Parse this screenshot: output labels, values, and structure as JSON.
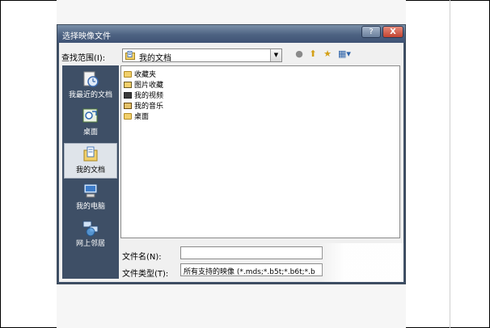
{
  "dialog": {
    "title": "选择映像文件",
    "help_glyph": "?",
    "close_glyph": "X"
  },
  "lookin": {
    "label": "查找范围(I):",
    "value": "我的文档",
    "arrow": "▼"
  },
  "toolbar": {
    "back": "●",
    "up": "⬆",
    "new_folder": "★",
    "views": "▦▾"
  },
  "places": [
    {
      "label": "我最近的文档",
      "icon": "recent-documents-icon"
    },
    {
      "label": "桌面",
      "icon": "desktop-icon"
    },
    {
      "label": "我的文档",
      "icon": "my-documents-icon",
      "selected": true
    },
    {
      "label": "我的电脑",
      "icon": "my-computer-icon"
    },
    {
      "label": "网上邻居",
      "icon": "network-places-icon"
    }
  ],
  "files": [
    {
      "name": "收藏夹",
      "icon": "folder-icon"
    },
    {
      "name": "图片收藏",
      "icon": "pictures-folder-icon"
    },
    {
      "name": "我的视频",
      "icon": "videos-folder-icon"
    },
    {
      "name": "我的音乐",
      "icon": "music-folder-icon"
    },
    {
      "name": "桌面",
      "icon": "folder-icon"
    }
  ],
  "filename": {
    "label": "文件名(N):",
    "value": ""
  },
  "filetype": {
    "label": "文件类型(T):",
    "value": "所有支持的映像 (*.mds;*.b5t;*.b6t;*.b"
  },
  "colors": {
    "titlebar": "#4d6282",
    "places_bg": "#3e4f66",
    "selected_place": "#dfe4ea",
    "close_button": "#c24431"
  }
}
